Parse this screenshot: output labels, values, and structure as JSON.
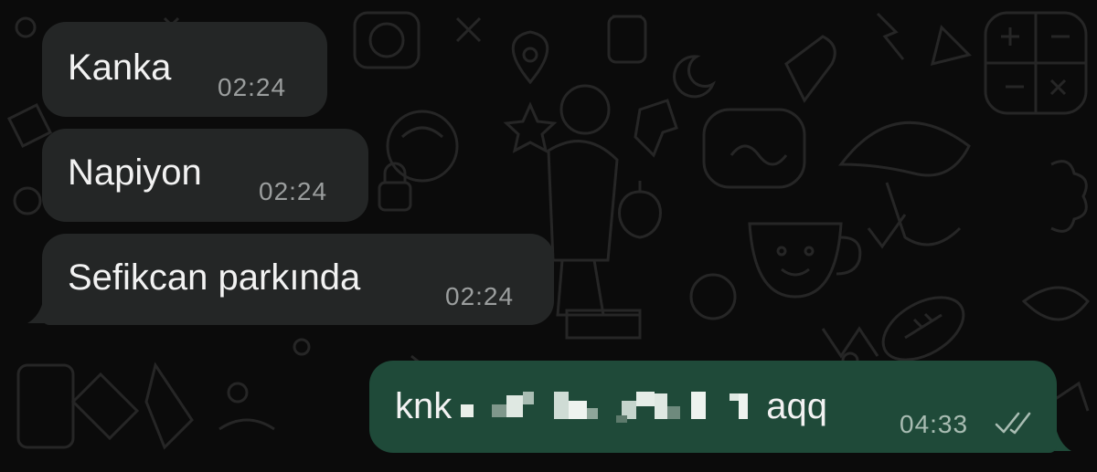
{
  "colors": {
    "background": "#0b0b0b",
    "incoming_bubble": "#242626",
    "outgoing_bubble": "#1f4a39",
    "timestamp": "#9b9e9e",
    "read_receipt": "#a8bcb2"
  },
  "messages": [
    {
      "direction": "incoming",
      "text": "Kanka",
      "time": "02:24"
    },
    {
      "direction": "incoming",
      "text": "Napiyon",
      "time": "02:24"
    },
    {
      "direction": "incoming",
      "text": "Sefikcan parkında",
      "time": "02:24"
    },
    {
      "direction": "outgoing",
      "text_start": "knk",
      "text_end": "aqq",
      "redacted": true,
      "time": "04:33",
      "status_icon": "double-check-icon"
    }
  ]
}
